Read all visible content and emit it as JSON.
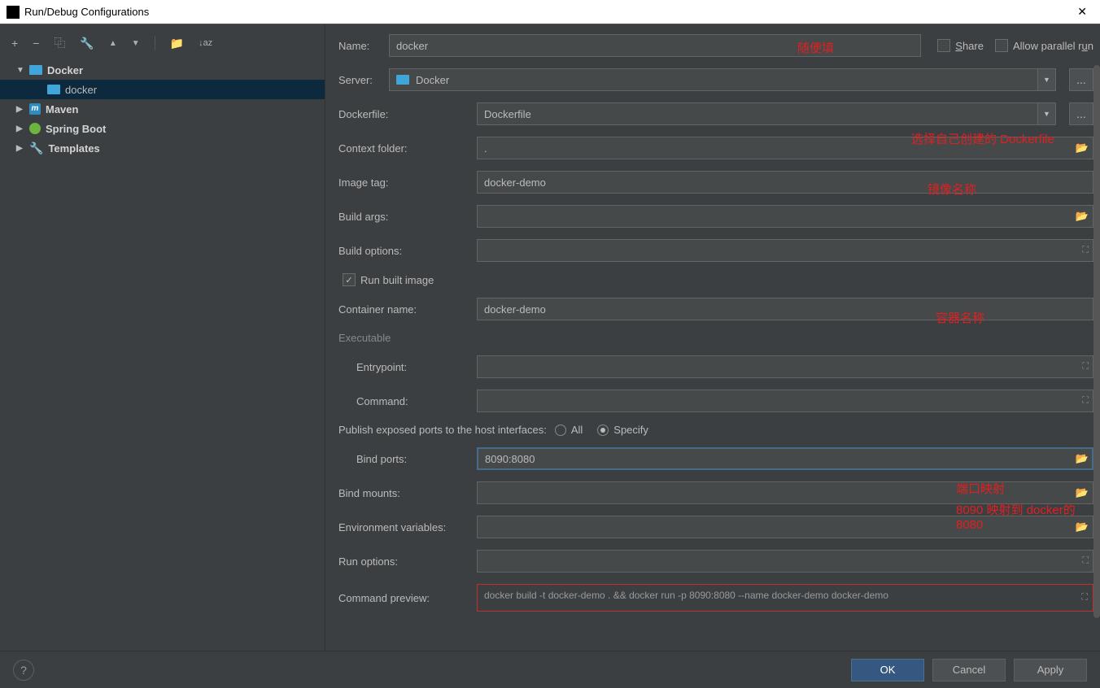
{
  "window": {
    "title": "Run/Debug Configurations"
  },
  "toolbar": {
    "add": "+",
    "remove": "−",
    "copy": "⿻",
    "wrench": "🔧",
    "up": "▲",
    "down": "▼",
    "folder": "📁",
    "sort": "↓az"
  },
  "tree": {
    "docker": "Docker",
    "docker_child": "docker",
    "maven": "Maven",
    "maven_m": "m",
    "spring": "Spring Boot",
    "templates": "Templates"
  },
  "form": {
    "name_label": "Name:",
    "name_value": "docker",
    "share_label": "Share",
    "parallel_label": "Allow parallel run",
    "server_label": "Server:",
    "server_value": "Docker",
    "dockerfile_label": "Dockerfile:",
    "dockerfile_value": "Dockerfile",
    "context_label": "Context folder:",
    "context_value": ".",
    "image_tag_label": "Image tag:",
    "image_tag_value": "docker-demo",
    "build_args_label": "Build args:",
    "build_options_label": "Build options:",
    "run_built_label": "Run built image",
    "container_name_label": "Container name:",
    "container_name_value": "docker-demo",
    "executable_label": "Executable",
    "entrypoint_label": "Entrypoint:",
    "command_label": "Command:",
    "publish_label": "Publish exposed ports to the host interfaces:",
    "all_label": "All",
    "specify_label": "Specify",
    "bind_ports_label": "Bind ports:",
    "bind_ports_value": "8090:8080",
    "bind_mounts_label": "Bind mounts:",
    "env_label": "Environment variables:",
    "run_options_label": "Run options:",
    "preview_label": "Command preview:",
    "preview_value": "docker build -t docker-demo . && docker run -p 8090:8080 --name docker-demo docker-demo"
  },
  "annotations": {
    "name": "随便填",
    "dockerfile": "选择自己创建的 Dockerfile",
    "image_tag": "镜像名称",
    "container": "容器名称",
    "bind_ports": "端口映射",
    "bind_ports2": "8090 映射到 docker的 8080"
  },
  "footer": {
    "help": "?",
    "ok": "OK",
    "cancel": "Cancel",
    "apply": "Apply"
  },
  "icons": {
    "ellipsis": "...",
    "chevron_down": "▼",
    "chevron_right": "▶",
    "folder": "📂",
    "expand": "⛶",
    "close": "✕",
    "check": "✓"
  }
}
